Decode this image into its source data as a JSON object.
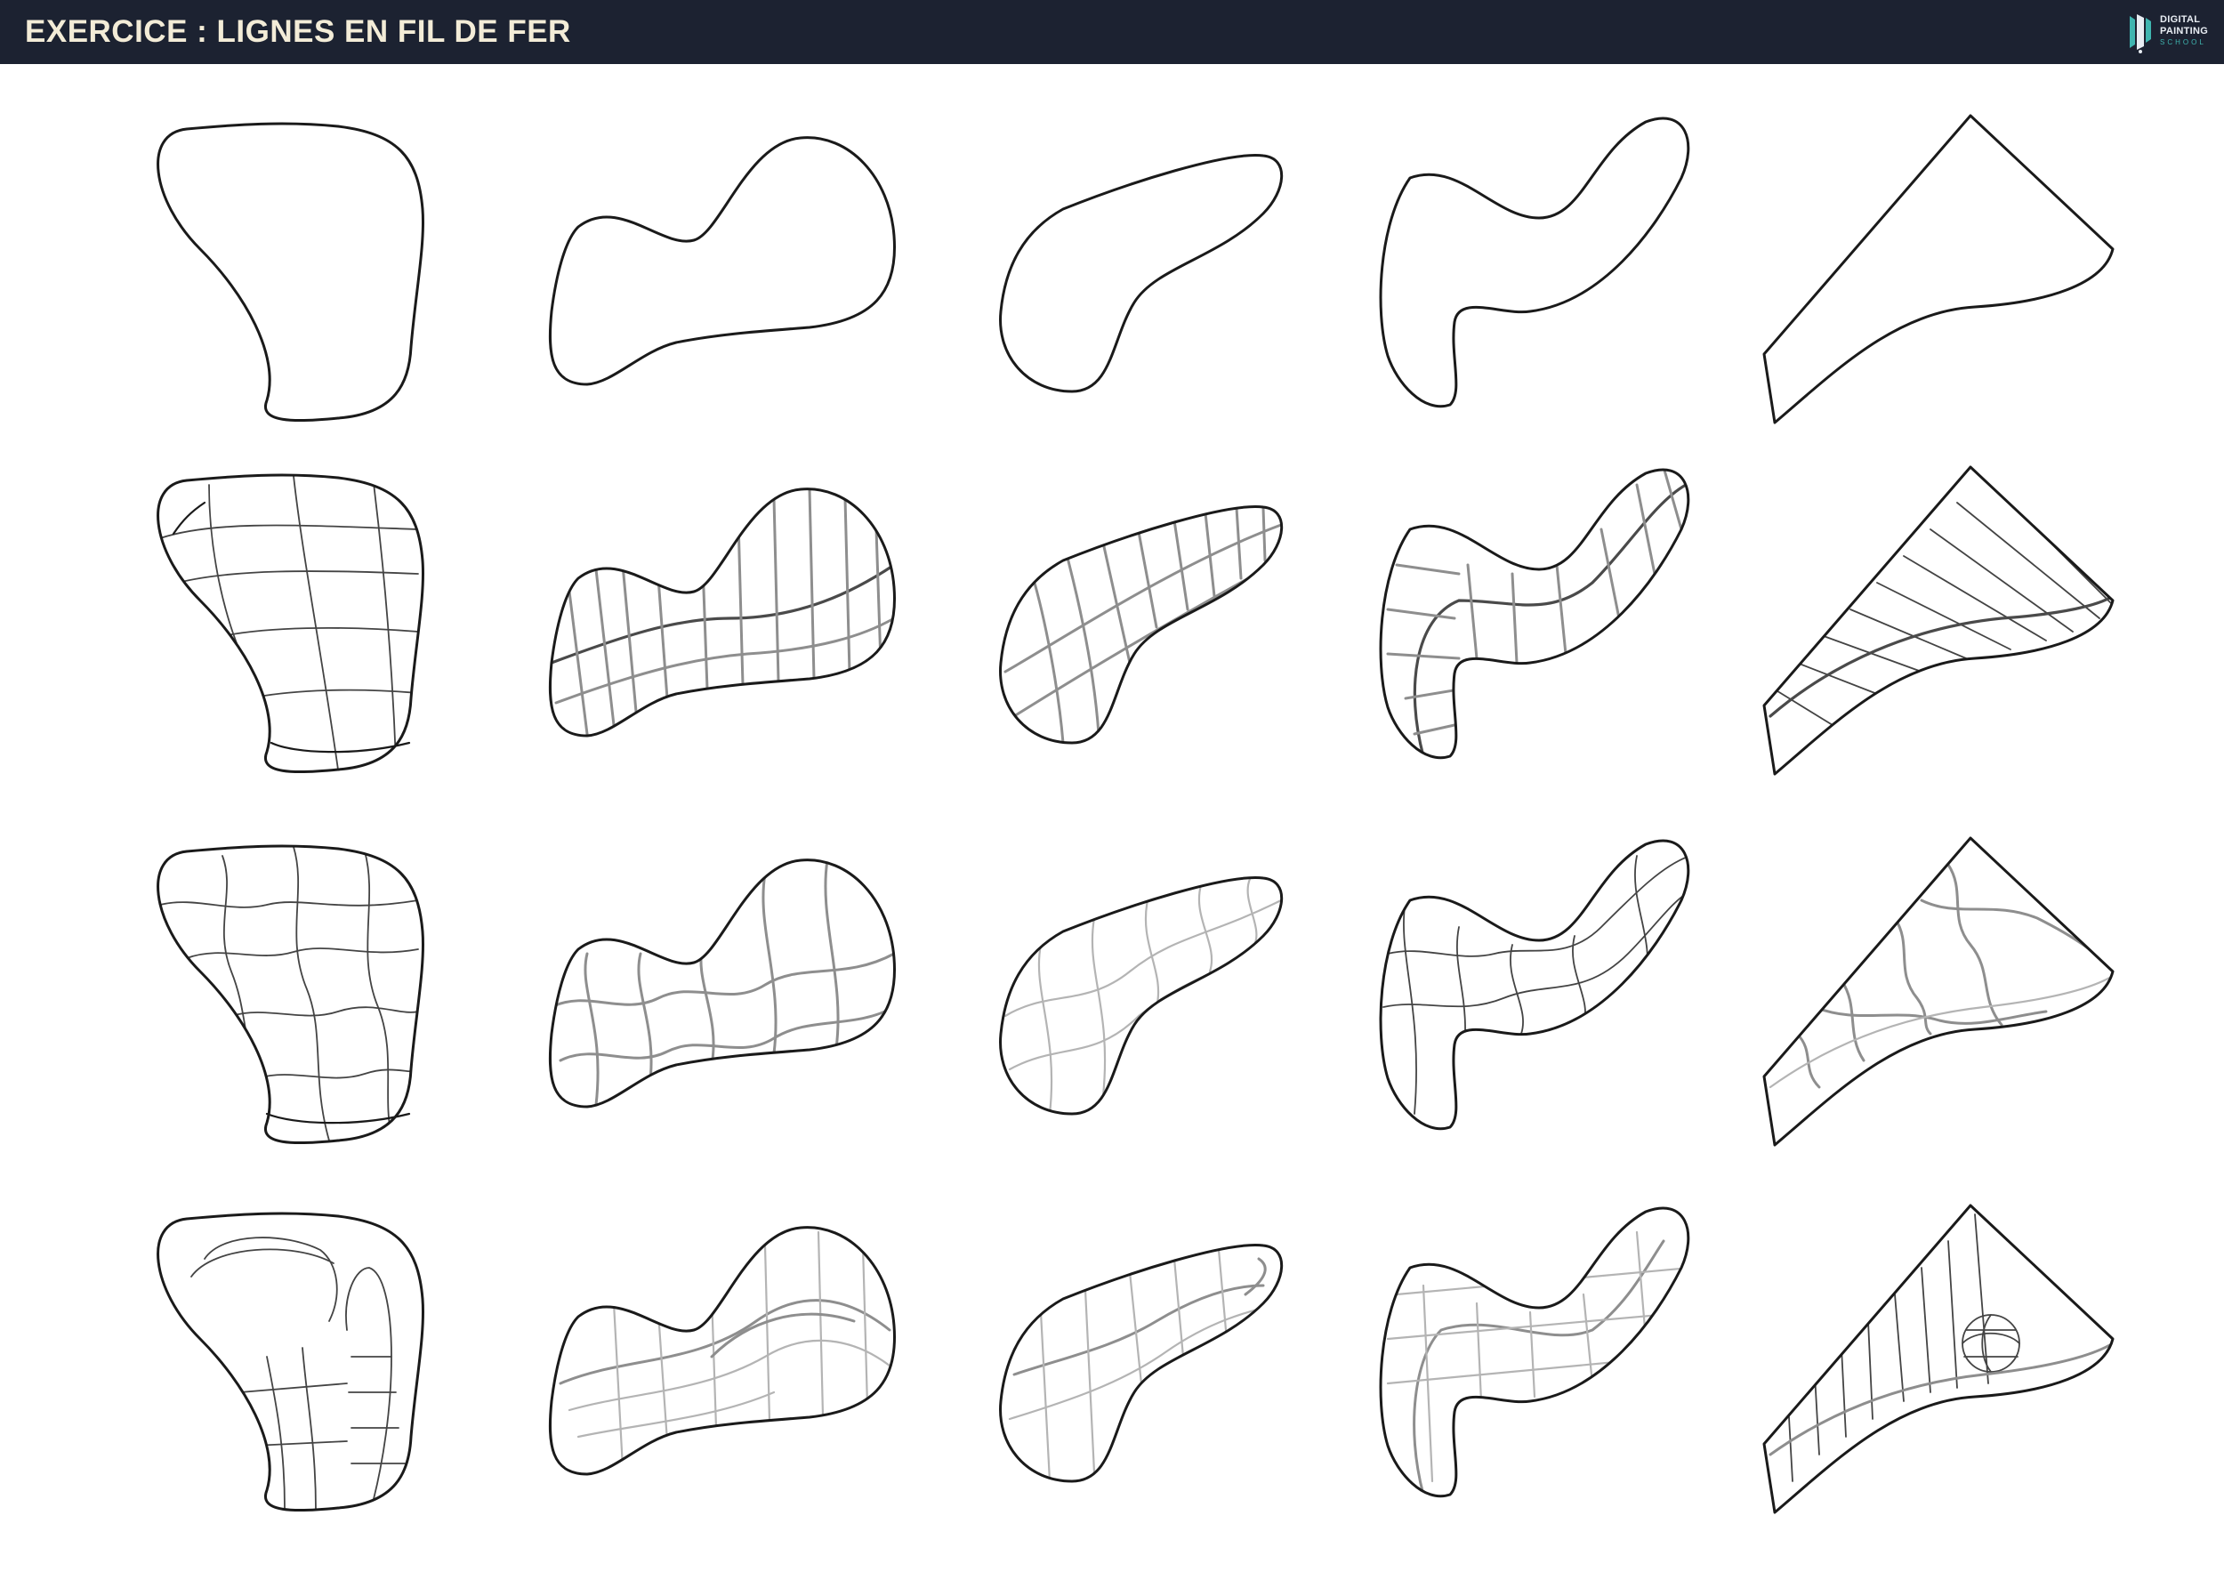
{
  "header": {
    "title": "EXERCICE : LIGNES EN FIL DE FER",
    "brand": {
      "line1": "DIGITAL",
      "line2": "PAINTING",
      "line3": "SCHOOL",
      "icon": "brush-logo-icon",
      "accent_color": "#3fb5b0"
    },
    "background_color": "#1c2231",
    "title_color": "#f3ecd7"
  },
  "grid": {
    "rows": 4,
    "columns": 5,
    "row_styles": [
      "outline",
      "regular-grid",
      "wavy-grid",
      "deformed-grid"
    ],
    "shape_names": [
      "blob",
      "hourglass-blob",
      "bean",
      "s-curve",
      "triangle-sail"
    ]
  }
}
